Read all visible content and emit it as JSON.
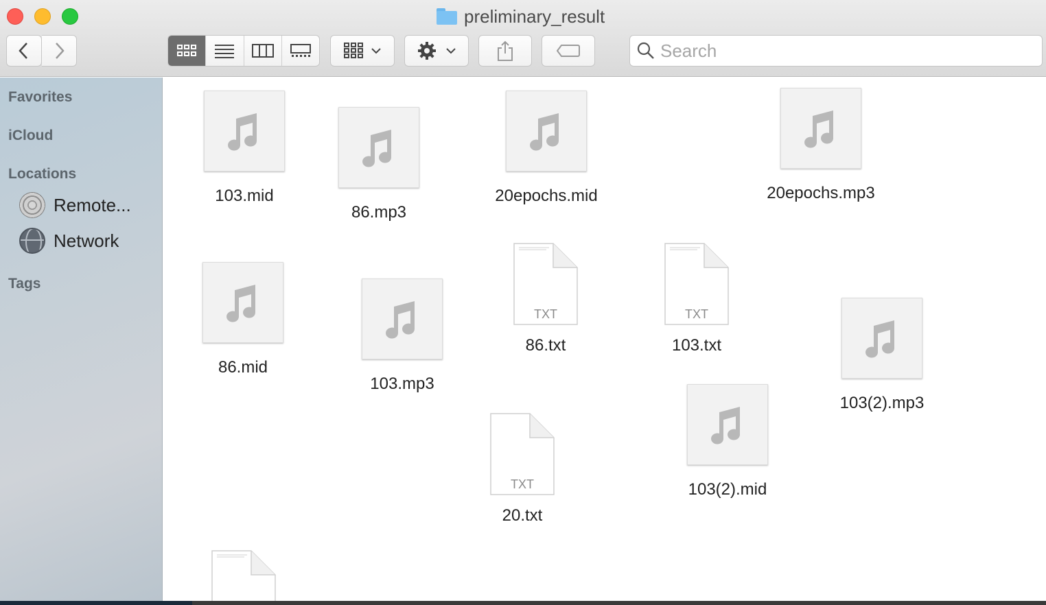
{
  "window": {
    "title": "preliminary_result"
  },
  "toolbar": {
    "back_icon": "chevron-left-icon",
    "forward_icon": "chevron-right-icon",
    "view_modes": [
      "icon-view",
      "list-view",
      "column-view",
      "gallery-view"
    ],
    "active_view": "icon-view",
    "search_placeholder": "Search"
  },
  "sidebar": {
    "favorites": "Favorites",
    "icloud": "iCloud",
    "locations": "Locations",
    "location_items": [
      {
        "label": "Remote...",
        "icon": "disk-icon"
      },
      {
        "label": "Network",
        "icon": "globe-icon"
      }
    ],
    "tags": "Tags"
  },
  "files": [
    {
      "name": "103.mid",
      "type": "audio"
    },
    {
      "name": "86.mp3",
      "type": "audio"
    },
    {
      "name": "20epochs.mid",
      "type": "audio"
    },
    {
      "name": "20epochs.mp3",
      "type": "audio"
    },
    {
      "name": "86.mid",
      "type": "audio"
    },
    {
      "name": "103.mp3",
      "type": "audio"
    },
    {
      "name": "86.txt",
      "type": "txt",
      "badge": "TXT"
    },
    {
      "name": "103.txt",
      "type": "txt",
      "badge": "TXT"
    },
    {
      "name": "103(2).mp3",
      "type": "audio"
    },
    {
      "name": "20.txt",
      "type": "txt",
      "badge": "TXT"
    },
    {
      "name": "103(2).mid",
      "type": "audio"
    },
    {
      "name": "",
      "type": "txt",
      "badge": ""
    }
  ],
  "colors": {
    "close": "#fe5f57",
    "minimize": "#febc2e",
    "zoom": "#28c840",
    "folder": "#7cc2f3"
  }
}
